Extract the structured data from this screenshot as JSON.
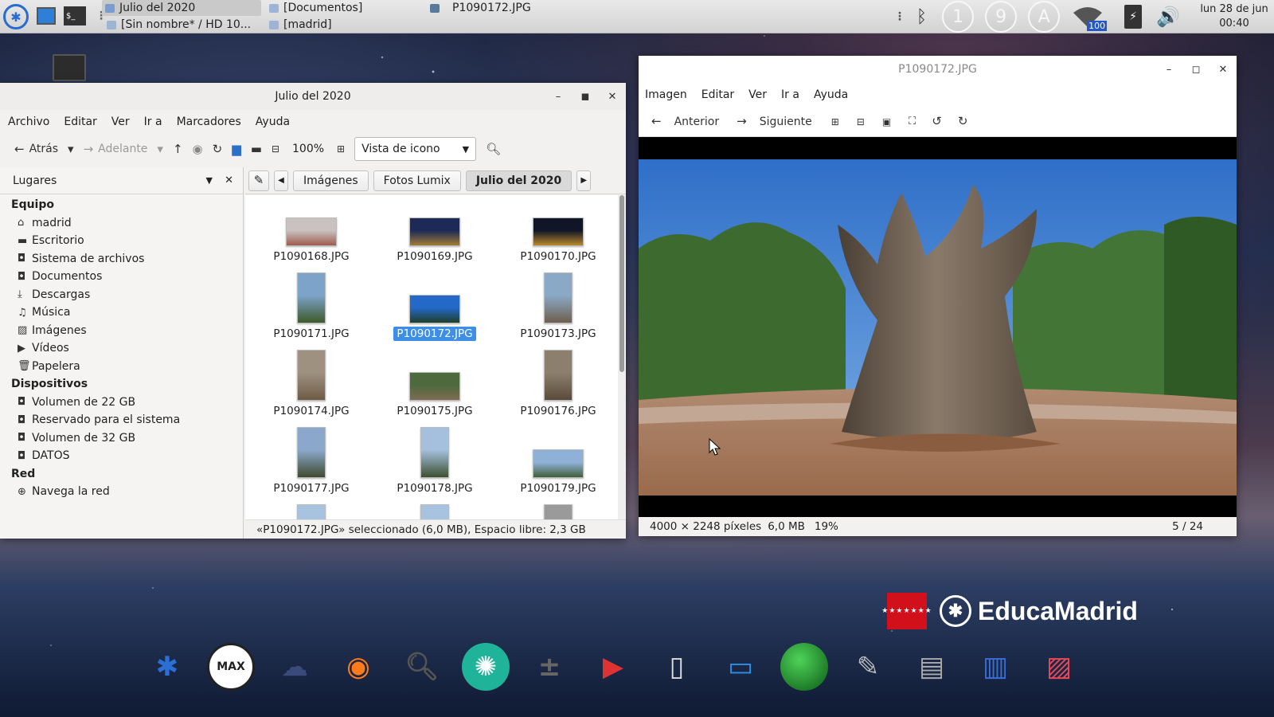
{
  "top_panel": {
    "tasks": [
      {
        "label": "Julio del 2020",
        "active": true
      },
      {
        "label": "[Sin nombre* / HD 10...",
        "active": false
      },
      {
        "label": "[Documentos]",
        "active": false
      },
      {
        "label": "[madrid]",
        "active": false
      },
      {
        "label": "P1090172.JPG",
        "active": false
      }
    ],
    "tray": {
      "indicator_1": "1",
      "indicator_9": "9",
      "indicator_a": "A",
      "wifi_badge": "100"
    },
    "clock_date": "lun 28 de jun",
    "clock_time": "00:40"
  },
  "file_manager": {
    "title": "Julio del 2020",
    "menu": [
      "Archivo",
      "Editar",
      "Ver",
      "Ir a",
      "Marcadores",
      "Ayuda"
    ],
    "toolbar": {
      "back": "Atrás",
      "forward": "Adelante",
      "zoom": "100%",
      "view": "Vista de icono"
    },
    "sidebar": {
      "header": "Lugares",
      "sections": [
        {
          "title": "Equipo",
          "items": [
            {
              "label": "madrid",
              "icon": "home"
            },
            {
              "label": "Escritorio",
              "icon": "desktop"
            },
            {
              "label": "Sistema de archivos",
              "icon": "drive"
            },
            {
              "label": "Documentos",
              "icon": "drive"
            },
            {
              "label": "Descargas",
              "icon": "download"
            },
            {
              "label": "Música",
              "icon": "music"
            },
            {
              "label": "Imágenes",
              "icon": "image"
            },
            {
              "label": "Vídeos",
              "icon": "video"
            },
            {
              "label": "Papelera",
              "icon": "trash"
            }
          ]
        },
        {
          "title": "Dispositivos",
          "items": [
            {
              "label": "Volumen de 22 GB",
              "icon": "drive"
            },
            {
              "label": "Reservado para el sistema",
              "icon": "drive"
            },
            {
              "label": "Volumen de 32 GB",
              "icon": "drive"
            },
            {
              "label": "DATOS",
              "icon": "drive"
            }
          ]
        },
        {
          "title": "Red",
          "items": [
            {
              "label": "Navega la red",
              "icon": "network"
            }
          ]
        }
      ]
    },
    "pathbar": [
      "Imágenes",
      "Fotos Lumix",
      "Julio del 2020"
    ],
    "files": [
      {
        "name": "P1090168.JPG",
        "orient": "land",
        "colors": [
          "#c9c2c0",
          "#9e5b4e"
        ]
      },
      {
        "name": "P1090169.JPG",
        "orient": "land",
        "colors": [
          "#1d2a58",
          "#a07a33"
        ]
      },
      {
        "name": "P1090170.JPG",
        "orient": "land",
        "colors": [
          "#101628",
          "#b8892a"
        ]
      },
      {
        "name": "P1090171.JPG",
        "orient": "port",
        "colors": [
          "#7da3c9",
          "#3d5a2c"
        ]
      },
      {
        "name": "P1090172.JPG",
        "orient": "land",
        "colors": [
          "#2468c8",
          "#1f3f2c"
        ],
        "selected": true
      },
      {
        "name": "P1090173.JPG",
        "orient": "port",
        "colors": [
          "#8aa9c6",
          "#6f5f4e"
        ]
      },
      {
        "name": "P1090174.JPG",
        "orient": "port",
        "colors": [
          "#9f9180",
          "#6d5b46"
        ]
      },
      {
        "name": "P1090175.JPG",
        "orient": "land",
        "colors": [
          "#4c6a3b",
          "#7f6b55"
        ]
      },
      {
        "name": "P1090176.JPG",
        "orient": "port",
        "colors": [
          "#8c7f6d",
          "#5a4a3a"
        ]
      },
      {
        "name": "P1090177.JPG",
        "orient": "port",
        "colors": [
          "#8ba8cc",
          "#3f4a2f"
        ]
      },
      {
        "name": "P1090178.JPG",
        "orient": "port",
        "colors": [
          "#a4c0dc",
          "#3d5031"
        ]
      },
      {
        "name": "P1090179.JPG",
        "orient": "land",
        "colors": [
          "#8fb1d8",
          "#41603a"
        ]
      },
      {
        "name": "",
        "orient": "port",
        "colors": [
          "#a7c3e0",
          "#5a5a5a"
        ]
      },
      {
        "name": "",
        "orient": "port",
        "colors": [
          "#a7c3e0",
          "#5a5a5a"
        ]
      },
      {
        "name": "",
        "orient": "port",
        "colors": [
          "#9a9a9a",
          "#6d6d6d"
        ]
      }
    ],
    "status": "«P1090172.JPG» seleccionado (6,0 MB), Espacio libre: 2,3 GB"
  },
  "image_viewer": {
    "title": "P1090172.JPG",
    "menu": [
      "Imagen",
      "Editar",
      "Ver",
      "Ir a",
      "Ayuda"
    ],
    "toolbar": {
      "previous": "Anterior",
      "next": "Siguiente"
    },
    "status": {
      "dimensions": "4000 × 2248 píxeles",
      "size": "6,0 MB",
      "zoom": "19%",
      "position": "5 / 24"
    }
  },
  "branding": {
    "text": "EducaMadrid",
    "flag_stars": "★★★★★★★"
  },
  "dock": [
    {
      "name": "max-star",
      "color": "#2b6fd6"
    },
    {
      "name": "max-inside",
      "color": "#ffffff"
    },
    {
      "name": "cloud",
      "color": "#3a4a7a"
    },
    {
      "name": "firefox",
      "color": "#ff7a1a"
    },
    {
      "name": "search",
      "color": "#555"
    },
    {
      "name": "shutter",
      "color": "#1fb39a"
    },
    {
      "name": "calculator",
      "color": "#666"
    },
    {
      "name": "screen-recorder",
      "color": "#d33"
    },
    {
      "name": "text-editor",
      "color": "#ddd"
    },
    {
      "name": "display",
      "color": "#2c8fe6"
    },
    {
      "name": "green-sphere",
      "color": "#1a8c2a"
    },
    {
      "name": "paint-brush",
      "color": "#bbb"
    },
    {
      "name": "files",
      "color": "#aaa"
    },
    {
      "name": "presentation",
      "color": "#3a6ed6"
    },
    {
      "name": "image-viewer",
      "color": "#e84a5a"
    }
  ]
}
